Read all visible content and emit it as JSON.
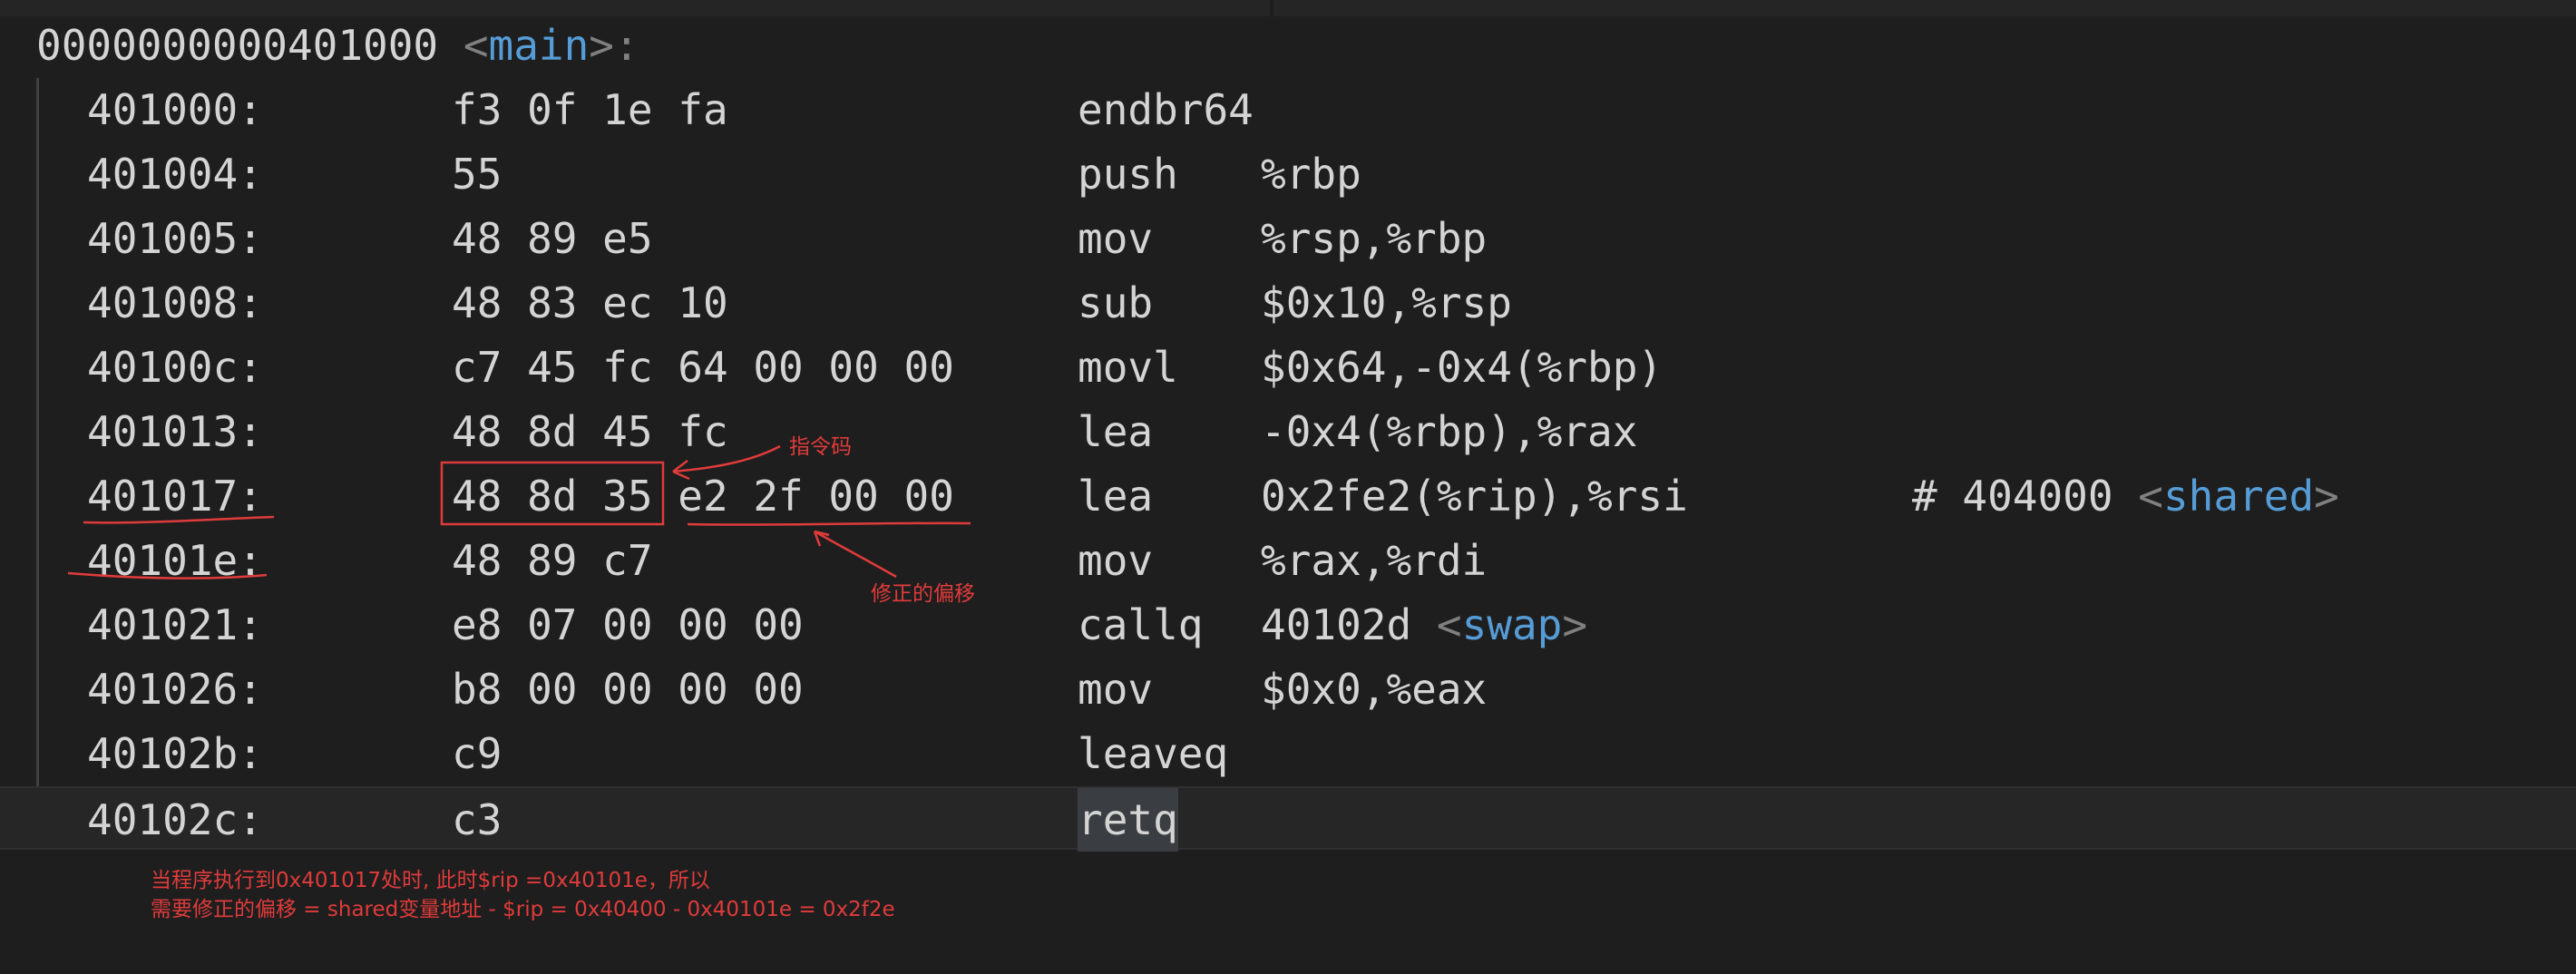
{
  "function_header": {
    "address": "0000000000401000",
    "open": "<",
    "name": "main",
    "close": ">:"
  },
  "rows": [
    {
      "addr": "401000:",
      "bytes": "f3 0f 1e fa",
      "mnemonic": "endbr64",
      "operands": "",
      "comment": ""
    },
    {
      "addr": "401004:",
      "bytes": "55",
      "mnemonic": "push",
      "operands": "%rbp",
      "comment": ""
    },
    {
      "addr": "401005:",
      "bytes": "48 89 e5",
      "mnemonic": "mov",
      "operands": "%rsp,%rbp",
      "comment": ""
    },
    {
      "addr": "401008:",
      "bytes": "48 83 ec 10",
      "mnemonic": "sub",
      "operands": "$0x10,%rsp",
      "comment": ""
    },
    {
      "addr": "40100c:",
      "bytes": "c7 45 fc 64 00 00 00",
      "mnemonic": "movl",
      "operands": "$0x64,-0x4(%rbp)",
      "comment": ""
    },
    {
      "addr": "401013:",
      "bytes": "48 8d 45 fc",
      "mnemonic": "lea",
      "operands": "-0x4(%rbp),%rax",
      "comment": ""
    },
    {
      "addr": "401017:",
      "bytes": "48 8d 35 e2 2f 00 00",
      "mnemonic": "lea",
      "operands": "0x2fe2(%rip),%rsi",
      "comment": "# 404000",
      "comment_symbol": "shared"
    },
    {
      "addr": "40101e:",
      "bytes": "48 89 c7",
      "mnemonic": "mov",
      "operands": "%rax,%rdi",
      "comment": ""
    },
    {
      "addr": "401021:",
      "bytes": "e8 07 00 00 00",
      "mnemonic": "callq",
      "operands": "40102d",
      "operand_symbol": "swap",
      "comment": ""
    },
    {
      "addr": "401026:",
      "bytes": "b8 00 00 00 00",
      "mnemonic": "mov",
      "operands": "$0x0,%eax",
      "comment": ""
    },
    {
      "addr": "40102b:",
      "bytes": "c9",
      "mnemonic": "leaveq",
      "operands": "",
      "comment": ""
    },
    {
      "addr": "40102c:",
      "bytes": "c3",
      "mnemonic": "retq",
      "operands": "",
      "comment": ""
    }
  ],
  "annotations": {
    "opcode_label": "指令码",
    "offset_label": "修正的偏移",
    "note_line1": "当程序执行到0x401017处时, 此时$rip =0x40101e，所以",
    "note_line2": "需要修正的偏移 = shared变量地址 - $rip = 0x40400 - 0x40101e = 0x2f2e"
  },
  "colors": {
    "background": "#1e1e1e",
    "text": "#d4d4d4",
    "symbol": "#569cd6",
    "bracket": "#808080",
    "annotation": "#e03b3b"
  }
}
